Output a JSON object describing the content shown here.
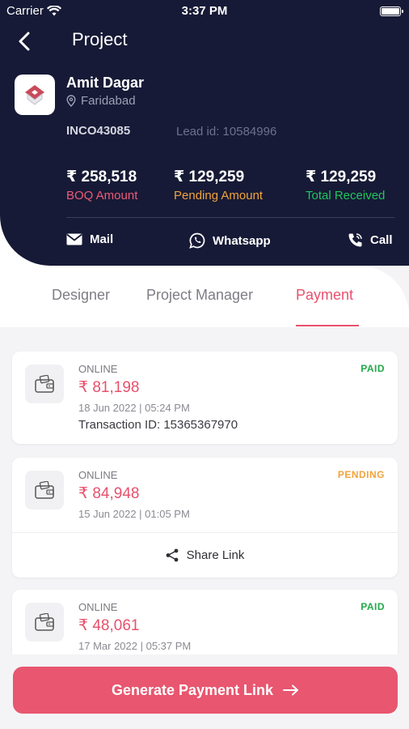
{
  "status_bar": {
    "carrier": "Carrier",
    "time": "3:37 PM"
  },
  "header": {
    "title": "Project",
    "client_name": "Amit Dagar",
    "location": "Faridabad",
    "project_code": "INCO43085",
    "lead_id": "Lead id: 10584996"
  },
  "amounts": [
    {
      "value": "₹ 258,518",
      "label": "BOQ Amount",
      "color": "#ef5a76"
    },
    {
      "value": "₹ 129,259",
      "label": "Pending Amount",
      "color": "#f2a33a"
    },
    {
      "value": "₹ 129,259",
      "label": "Total Received",
      "color": "#22c55e"
    }
  ],
  "actions": {
    "mail": "Mail",
    "whatsapp": "Whatsapp",
    "call": "Call"
  },
  "tabs": [
    {
      "label": "Designer",
      "active": false
    },
    {
      "label": "Project Manager",
      "active": false
    },
    {
      "label": "Payment",
      "active": true
    }
  ],
  "payments": [
    {
      "mode": "ONLINE",
      "amount": "₹ 81,198",
      "date": "18 Jun 2022 | 05:24 PM",
      "transaction": "Transaction ID:  15365367970",
      "status": "PAID",
      "status_color": "#22a94a"
    },
    {
      "mode": "ONLINE",
      "amount": "₹ 84,948",
      "date": "15 Jun 2022 | 01:05 PM",
      "status": "PENDING",
      "status_color": "#f2a33a",
      "share_label": "Share Link"
    },
    {
      "mode": "ONLINE",
      "amount": "₹ 48,061",
      "date": "17 Mar 2022 | 05:37 PM",
      "status": "PAID",
      "status_color": "#22a94a"
    }
  ],
  "cta": {
    "label": "Generate Payment Link"
  },
  "colors": {
    "header_bg": "#161a36",
    "accent": "#e8506c",
    "button": "#e8566f"
  }
}
